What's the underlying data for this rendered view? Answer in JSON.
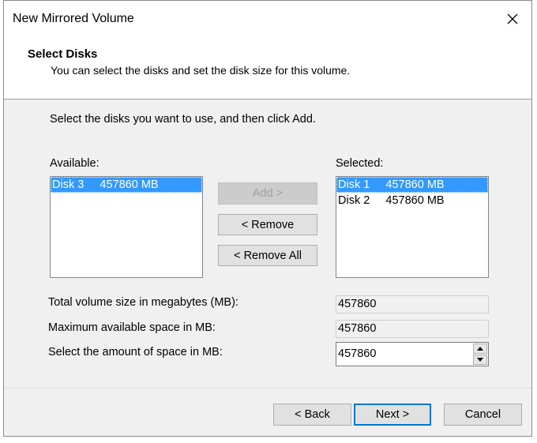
{
  "dialog": {
    "title": "New Mirrored Volume",
    "header_title": "Select Disks",
    "header_subtitle": "You can select the disks and set the disk size for this volume.",
    "instruction": "Select the disks you want to use, and then click Add."
  },
  "available": {
    "label": "Available:",
    "items": [
      {
        "label": "Disk 3     457860 MB",
        "selected": true
      }
    ]
  },
  "selected": {
    "label": "Selected:",
    "items": [
      {
        "label": "Disk 1     457860 MB",
        "selected": true
      },
      {
        "label": "Disk 2     457860 MB",
        "selected": false
      }
    ]
  },
  "buttons": {
    "add": "Add >",
    "remove": "< Remove",
    "remove_all": "< Remove All",
    "back": "< Back",
    "next": "Next >",
    "cancel": "Cancel"
  },
  "fields": {
    "total_label": "Total volume size in megabytes (MB):",
    "total_value": "457860",
    "max_label": "Maximum available space in MB:",
    "max_value": "457860",
    "amount_label": "Select the amount of space in MB:",
    "amount_value": "457860"
  },
  "icons": {
    "close": "close-icon",
    "spin_up": "chevron-up-icon",
    "spin_down": "chevron-down-icon"
  }
}
